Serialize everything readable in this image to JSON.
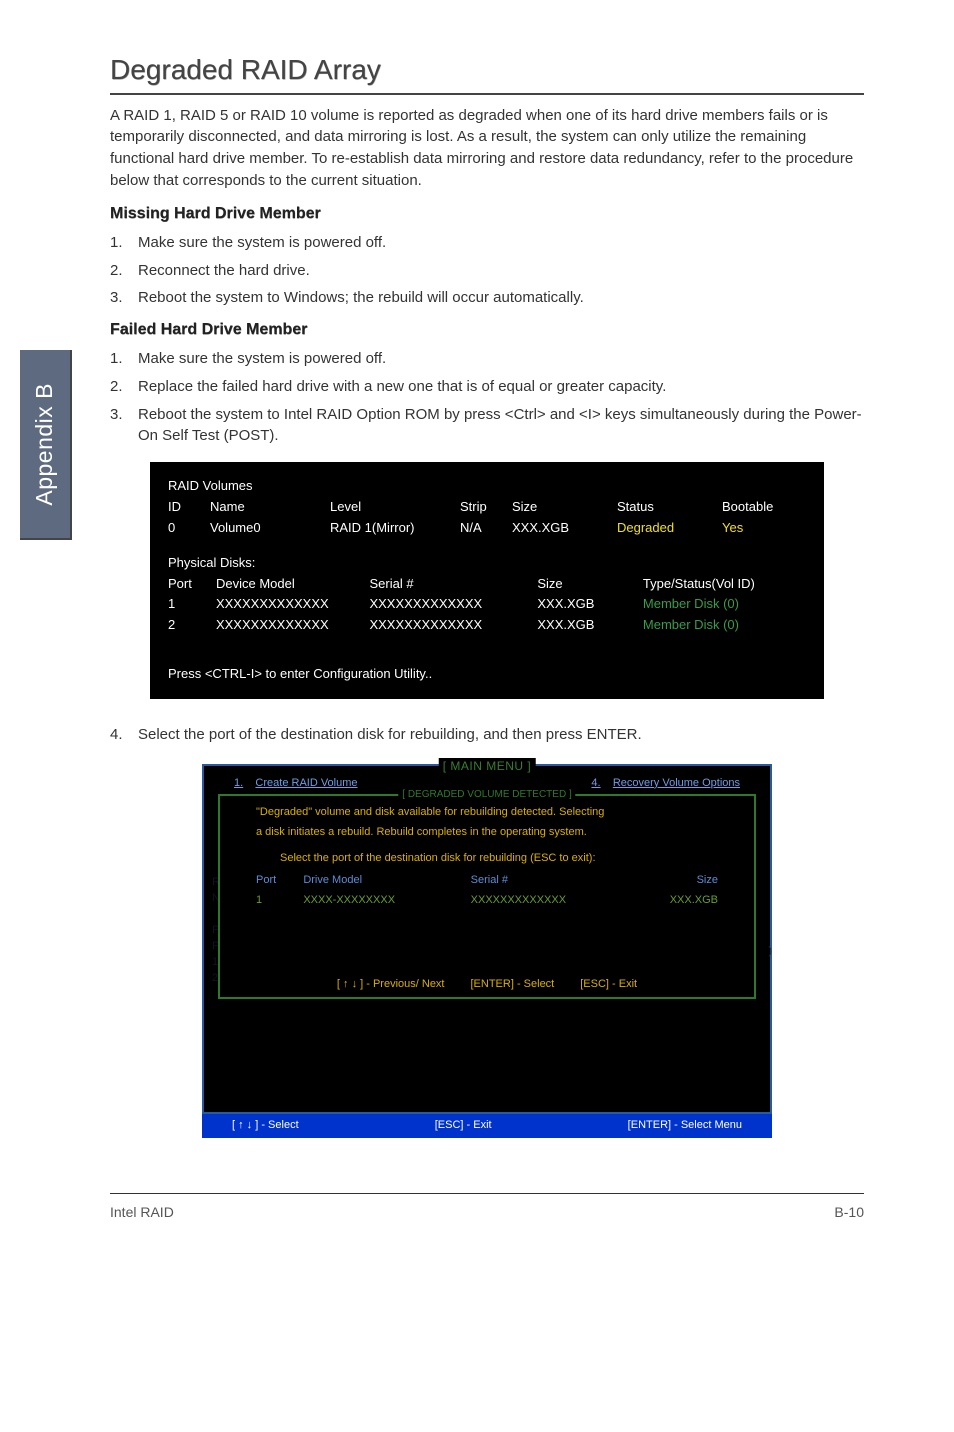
{
  "sidebar": {
    "label": "Appendix B"
  },
  "page": {
    "title": "Degraded RAID Array",
    "intro": "A RAID 1, RAID 5 or RAID 10 volume is reported as degraded when one of its hard drive members fails or is temporarily disconnected, and data mirroring is lost. As a result, the system can only utilize the remaining functional hard drive member. To re-establish data mirroring and restore data redundancy, refer to the procedure below that corresponds to the current situation.",
    "missing_header": "Missing Hard Drive Member",
    "missing_steps": [
      "Make sure the system is powered off.",
      "Reconnect the hard drive.",
      "Reboot the system to Windows; the rebuild will occur automatically."
    ],
    "failed_header": "Failed Hard Drive Member",
    "failed_steps": [
      "Make sure the system is powered off.",
      "Replace the failed hard drive with a new one that is of equal or greater capacity.",
      "Reboot the system to Intel RAID Option ROM by press <Ctrl> and <I> keys simultaneously during the Power-On Self Test (POST)."
    ],
    "step4": "Select the port of the destination disk for rebuilding, and then press ENTER."
  },
  "box1": {
    "raid_header": "RAID Volumes",
    "cols": {
      "id": "ID",
      "name": "Name",
      "level": "Level",
      "strip": "Strip",
      "size": "Size",
      "status": "Status",
      "bootable": "Bootable"
    },
    "row": {
      "id": "0",
      "name": "Volume0",
      "level": "RAID 1(Mirror)",
      "strip": "N/A",
      "size": "XXX.XGB",
      "status": "Degraded",
      "bootable": "Yes"
    },
    "phys_header": "Physical Disks:",
    "pcols": {
      "port": "Port",
      "model": "Device Model",
      "serial": "Serial #",
      "size": "Size",
      "type": "Type/Status(Vol ID)"
    },
    "prows": [
      {
        "port": "1",
        "model": "XXXXXXXXXXXXX",
        "serial": "XXXXXXXXXXXXX",
        "size": "XXX.XGB",
        "type": "Member  Disk (0)"
      },
      {
        "port": "2",
        "model": "XXXXXXXXXXXXX",
        "serial": "XXXXXXXXXXXXX",
        "size": "XXX.XGB",
        "type": "Member  Disk (0)"
      }
    ],
    "press": "Press  <CTRL-I>  to enter Configuration Utility.."
  },
  "box2": {
    "main_title": "[   MAIN  MENU   ]",
    "menu_left_num": "1.",
    "menu_left": "Create  RAID  Volume",
    "menu_right_num": "4.",
    "menu_right": "Recovery Volume  Options",
    "green_title": "[  DEGRADED VOLUME DETECTED  ]",
    "msg1": "\"Degraded\" volume and disk available for rebuilding detected. Selecting",
    "msg2": "a disk initiates a rebuild. Rebuild completes in the  operating system.",
    "prompt": "Select the port of the destination disk for rebuilding (ESC to exit):",
    "thead": {
      "port": "Port",
      "model": "Drive  Model",
      "serial": "Serial  #",
      "size": "Size"
    },
    "trow": {
      "port": "1",
      "model": "XXXX-XXXXXXXX",
      "serial": "XXXXXXXXXXXXX",
      "size": "XXX.XGB"
    },
    "innerfooter": {
      "nav": "[ ↑ ↓ ] - Previous/ Next",
      "select": "[ENTER] - Select",
      "exit": "[ESC] - Exit"
    },
    "bottomstrip": {
      "select": "[ ↑ ↓ ] - Select",
      "exit": "[ESC] - Exit",
      "menu": "[ENTER] - Select Menu"
    }
  },
  "footer": {
    "left": "Intel RAID",
    "right": "B-10"
  }
}
